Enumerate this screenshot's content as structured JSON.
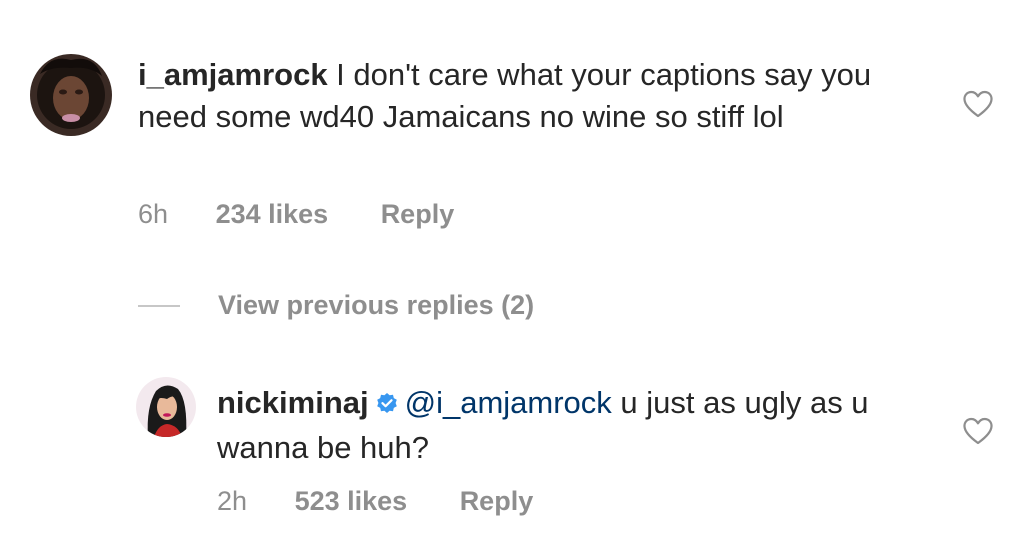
{
  "comments": [
    {
      "username": "i_amjamrock",
      "text": " I don't care what your captions say you need some wd40 Jamaicans no wine so stiff lol",
      "time": "6h",
      "likes": "234 likes",
      "reply": "Reply",
      "avatar_icon": "profile-photo-woman"
    }
  ],
  "view_replies": {
    "label": "View previous replies (2)"
  },
  "replies": [
    {
      "username": "nickiminaj",
      "verified": true,
      "mention": "@i_amjamrock",
      "text": " u just as ugly as u wanna be huh?",
      "time": "2h",
      "likes": "523 likes",
      "reply": "Reply",
      "avatar_icon": "profile-cartoon-avatar"
    }
  ],
  "colors": {
    "text": "#262626",
    "meta": "#8e8e8e",
    "mention": "#003569",
    "verified": "#3897f0"
  },
  "icons": {
    "like": "heart-outline-icon",
    "verified": "verified-badge-icon"
  }
}
